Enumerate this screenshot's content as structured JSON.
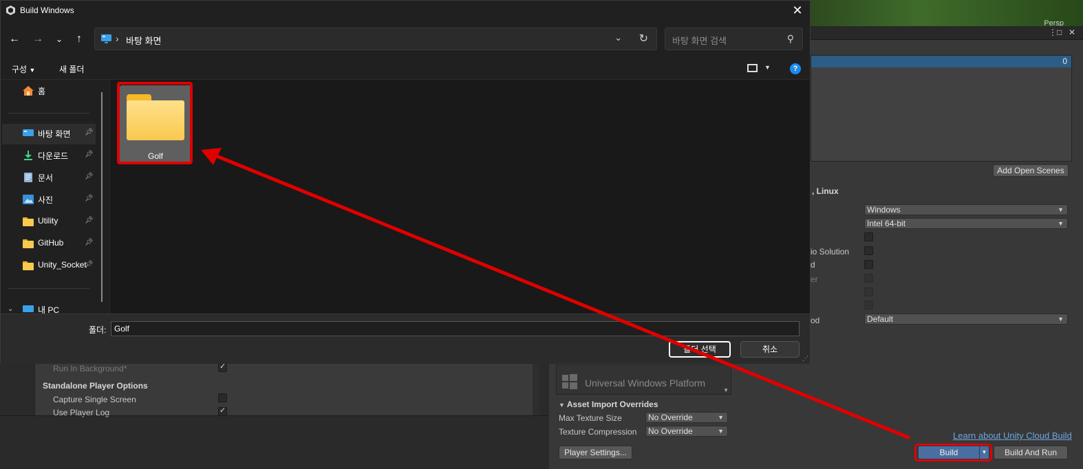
{
  "dialog": {
    "title": "Build Windows",
    "close": "✕",
    "address_path": "바탕 화면",
    "search_placeholder": "바탕 화면 검색",
    "commands": {
      "organize": "구성",
      "new_folder": "새 폴더"
    },
    "sidebar": {
      "home": "홈",
      "pinned": [
        {
          "label": "바탕 화면",
          "icon": "desktop-icon"
        },
        {
          "label": "다운로드",
          "icon": "download-icon"
        },
        {
          "label": "문서",
          "icon": "document-icon"
        },
        {
          "label": "사진",
          "icon": "picture-icon"
        },
        {
          "label": "Utility",
          "icon": "folder-icon"
        },
        {
          "label": "GitHub",
          "icon": "folder-icon"
        },
        {
          "label": "Unity_Socket",
          "icon": "folder-icon"
        }
      ],
      "this_pc": "내 PC"
    },
    "items": [
      {
        "name": "Golf",
        "type": "folder"
      }
    ],
    "footer": {
      "folder_label": "폴더:",
      "folder_value": "Golf",
      "select_button": "폴더 선택",
      "cancel_button": "취소"
    }
  },
  "unity": {
    "scene_persp": "Persp",
    "scene_index": "0",
    "add_open_scenes": "Add Open Scenes",
    "platform_heading_fragment": ", Linux",
    "settings": {
      "target_platform": "Windows",
      "architecture": "Intel 64-bit",
      "vs_solution_fragment": "io Solution",
      "fragment_d": "d",
      "fragment_er": "er",
      "compression_fragment": "od",
      "compression_method": "Default"
    },
    "player_settings_panel": {
      "run_in_background": "Run In Background*",
      "standalone_header": "Standalone Player Options",
      "capture_single_screen": "Capture Single Screen",
      "use_player_log": "Use Player Log"
    },
    "uwp_platform": "Universal Windows Platform",
    "asset_import_overrides": "Asset Import Overrides",
    "max_texture_size_label": "Max Texture Size",
    "max_texture_size_value": "No Override",
    "texture_compression_label": "Texture Compression",
    "texture_compression_value": "No Override",
    "player_settings_button": "Player Settings...",
    "cloud_build_link": "Learn about Unity Cloud Build",
    "build_button": "Build",
    "build_and_run_button": "Build And Run"
  },
  "colors": {
    "highlight": "#e00000",
    "accent": "#1a8cf0",
    "unity_selection": "#2c5d87"
  }
}
